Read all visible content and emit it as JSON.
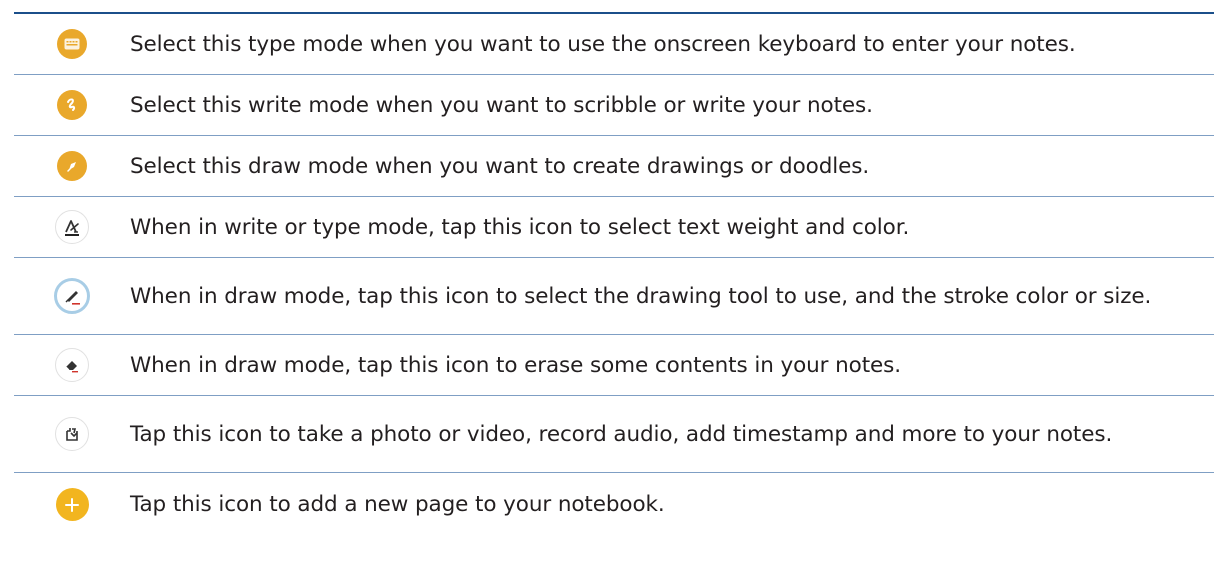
{
  "rows": [
    {
      "icon": "keyboard-icon",
      "text": "Select this type mode when you want to use the onscreen keyboard to enter your notes."
    },
    {
      "icon": "scribble-icon",
      "text": "Select this write mode when you want to scribble or write your notes."
    },
    {
      "icon": "pen-icon",
      "text": "Select this draw mode when you want to create drawings or doodles."
    },
    {
      "icon": "text-weight-icon",
      "text": "When in write or type mode, tap this icon to select text weight and color."
    },
    {
      "icon": "drawing-tool-icon",
      "text": "When in draw mode, tap this icon to select the drawing tool to use, and the stroke color or size."
    },
    {
      "icon": "eraser-icon",
      "text": "When in draw mode, tap this icon to erase some contents in your notes."
    },
    {
      "icon": "insert-icon",
      "text": "Tap this icon to take a photo or video, record audio, add timestamp and more to your notes."
    },
    {
      "icon": "add-page-icon",
      "text": "Tap this icon to add a new page to your notebook."
    }
  ],
  "colors": {
    "mode_yellow": "#e9a82b",
    "plus_yellow": "#f2b51f",
    "rule_blue": "#1b4f8a",
    "ring_blue": "#a8cde6"
  }
}
